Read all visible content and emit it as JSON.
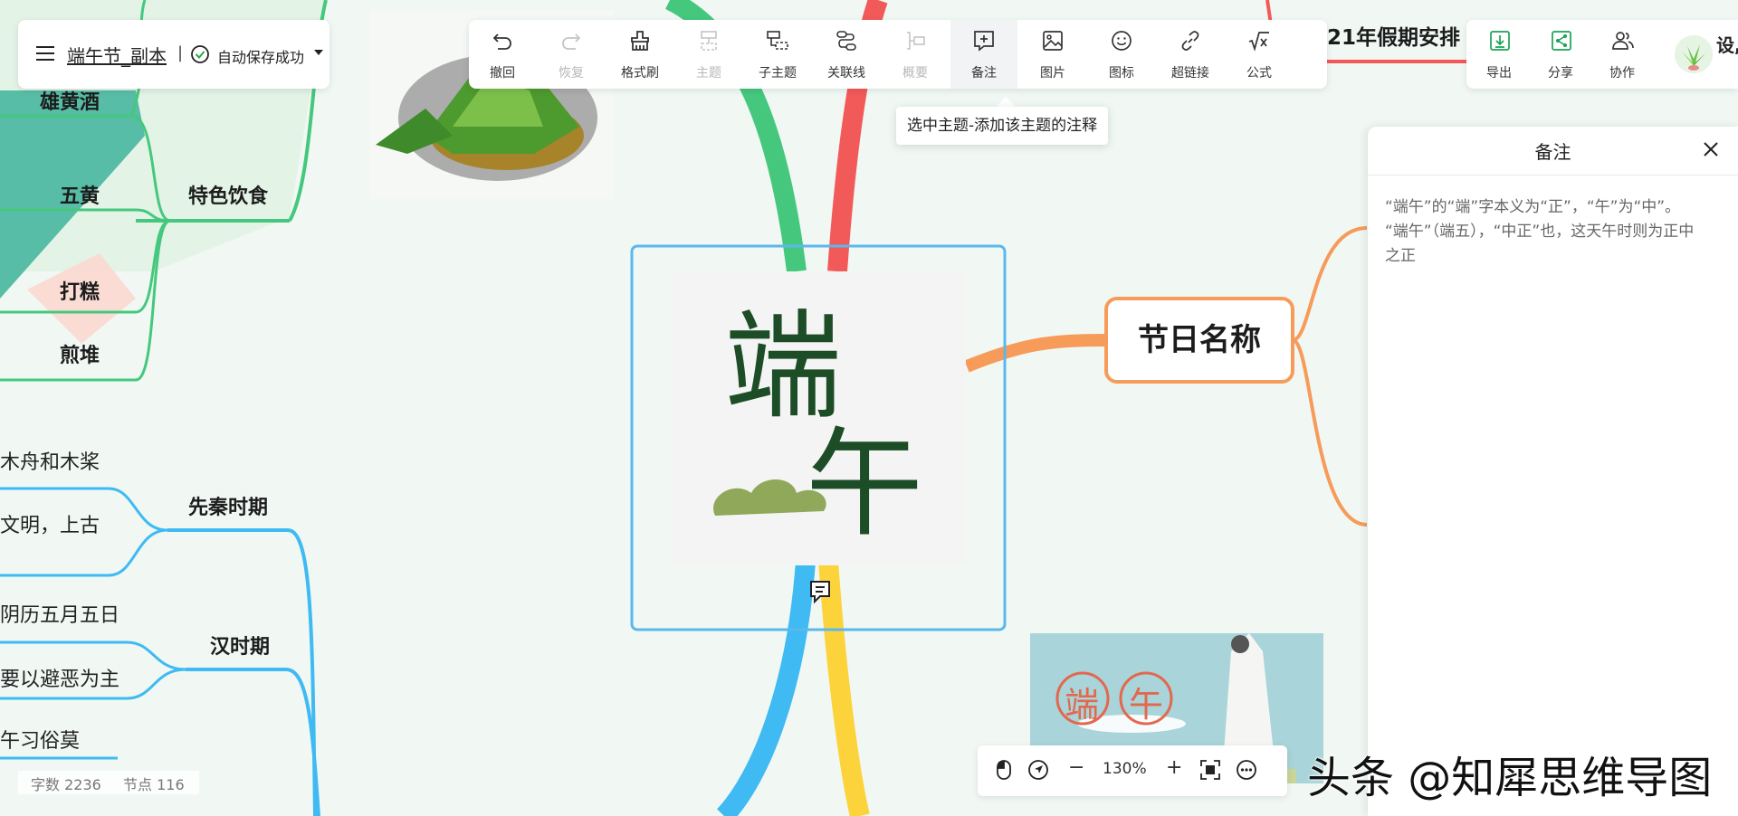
{
  "file": {
    "title": "端午节_副本",
    "separator": "|",
    "save_status": "自动保存成功"
  },
  "toolbar": {
    "items": [
      {
        "label": "撤回",
        "icon": "undo-icon",
        "disabled": false
      },
      {
        "label": "恢复",
        "icon": "redo-icon",
        "disabled": true
      },
      {
        "label": "格式刷",
        "icon": "format-brush-icon",
        "disabled": false
      },
      {
        "label": "主题",
        "icon": "topic-icon",
        "disabled": true
      },
      {
        "label": "子主题",
        "icon": "subtopic-icon",
        "disabled": false
      },
      {
        "label": "关联线",
        "icon": "relation-line-icon",
        "disabled": false
      },
      {
        "label": "概要",
        "icon": "summary-icon",
        "disabled": true
      },
      {
        "label": "备注",
        "icon": "note-icon",
        "disabled": false,
        "active": true
      },
      {
        "label": "图片",
        "icon": "image-icon",
        "disabled": false
      },
      {
        "label": "图标",
        "icon": "emoji-icon",
        "disabled": false
      },
      {
        "label": "超链接",
        "icon": "link-icon",
        "disabled": false
      },
      {
        "label": "公式",
        "icon": "formula-icon",
        "disabled": false
      }
    ],
    "tooltip": "选中主题-添加该主题的注释"
  },
  "topright": {
    "items": [
      {
        "label": "导出",
        "icon": "export-icon"
      },
      {
        "label": "分享",
        "icon": "share-icon"
      },
      {
        "label": "协作",
        "icon": "collaborate-icon"
      }
    ],
    "cut_text": "设,"
  },
  "notes": {
    "title": "备注",
    "lines": [
      "“端午”的“端”字本义为“正”，“午”为“中”。",
      "“端午”（端五），“中正”也，这天午时则为正中",
      "之正"
    ]
  },
  "map": {
    "center_calligraphy": "端午",
    "stamp_chars": [
      "端",
      "午"
    ],
    "top_banner": "21年假期安排",
    "right_branch": "节日名称",
    "groups": {
      "food": {
        "label": "特色饮食",
        "items": [
          "雄黄酒",
          "五黄",
          "打糕",
          "煎堆"
        ]
      },
      "xianqin": {
        "label": "先秦时期",
        "items": [
          "木舟和木桨",
          "文明，上古"
        ]
      },
      "han": {
        "label": "汉时期",
        "items": [
          "阴历五月五日",
          "要以避恶为主",
          "午习俗莫"
        ]
      }
    }
  },
  "stats": {
    "words": "字数 2236",
    "nodes": "节点 116"
  },
  "zoom": {
    "level": "130%",
    "minus": "−",
    "plus": "+"
  },
  "watermark": "头条 @知犀思维导图",
  "colors": {
    "green_branch": "#45c87e",
    "red_branch": "#f25a5a",
    "blue_branch": "#3fbaf2",
    "yellow_branch": "#fdd33b",
    "orange_branch": "#f79b5a",
    "selection": "#5ab8ee"
  }
}
